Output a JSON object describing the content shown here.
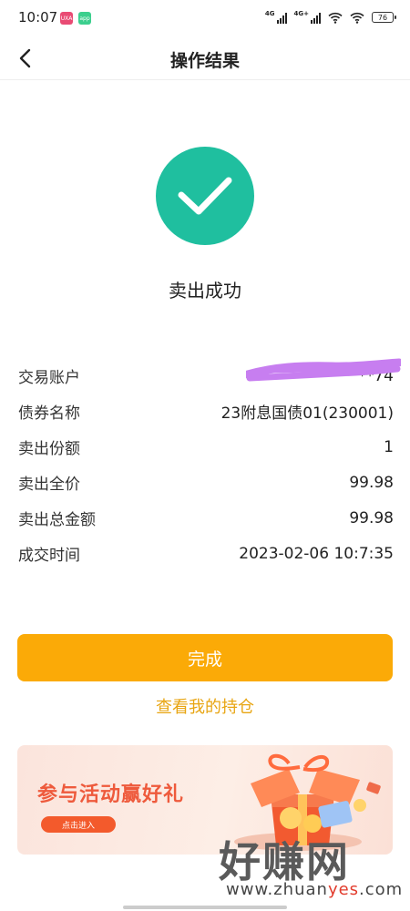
{
  "status_bar": {
    "time": "10:07",
    "notif_a": "UXA",
    "notif_b": "app",
    "net1": "4G",
    "net2": "4G+",
    "battery": "76"
  },
  "nav": {
    "back_icon": "chevron-left-icon",
    "title": "操作结果"
  },
  "result": {
    "icon": "check-circle-icon",
    "icon_color": "#1fbf9f",
    "message": "卖出成功"
  },
  "details": [
    {
      "label": "交易账户",
      "value": "**74"
    },
    {
      "label": "债券名称",
      "value": "23附息国债01(230001)"
    },
    {
      "label": "卖出份额",
      "value": "1"
    },
    {
      "label": "卖出全价",
      "value": "99.98"
    },
    {
      "label": "卖出总金额",
      "value": "99.98"
    },
    {
      "label": "成交时间",
      "value": "2023-02-06 10:7:35"
    }
  ],
  "actions": {
    "done_label": "完成",
    "done_color": "#fbaa07",
    "view_positions_label": "查看我的持仓",
    "link_color": "#e8a512"
  },
  "banner": {
    "title": "参与活动赢好礼",
    "button": "点击进入"
  },
  "watermark": {
    "main": "好赚网",
    "sub_prefix": "www.zhuan",
    "sub_accent": "yes",
    "sub_suffix": ".com"
  }
}
